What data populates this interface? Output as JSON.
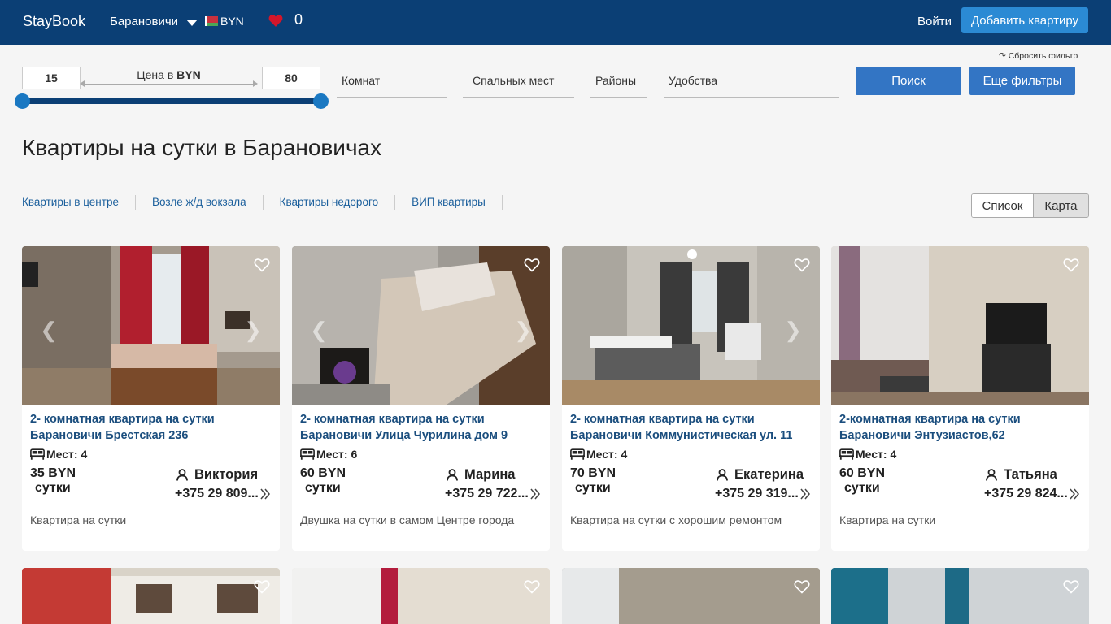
{
  "header": {
    "logo": "StayBook",
    "city": "Барановичи",
    "currency": "BYN",
    "favorites_count": "0",
    "login": "Войти",
    "add_apartment": "Добавить квартиру",
    "brand_color": "#0b3f75"
  },
  "filters": {
    "reset": "↷ Сбросить фильтр",
    "price_min": "15",
    "price_max": "80",
    "price_label_prefix": "Цена в ",
    "price_label_currency": "BYN",
    "rooms": "Комнат",
    "sleeping_places": "Спальных мест",
    "districts": "Районы",
    "amenities": "Удобства",
    "search": "Поиск",
    "more_filters": "Еще фильтры"
  },
  "page_title": "Квартиры на сутки в Барановичах",
  "quick_links": [
    "Квартиры в центре",
    "Возле ж/д вокзала",
    "Квартиры недорого",
    "ВИП квартиры"
  ],
  "view_toggle": {
    "list": "Список",
    "map": "Карта"
  },
  "listings": [
    {
      "title": "2- комнатная квартира на сутки Барановичи Брестская 236",
      "seats": "Мест: 4",
      "price": "35 BYN",
      "unit": "сутки",
      "owner": "Виктория",
      "phone": "+375 29 809...",
      "description": "Квартира на сутки"
    },
    {
      "title": "2- комнатная квартира на сутки Барановичи Улица Чурилина дом 9",
      "seats": "Мест: 6",
      "price": "60 BYN",
      "unit": "сутки",
      "owner": "Марина",
      "phone": "+375 29 722...",
      "description": "Двушка на сутки в самом Центре города"
    },
    {
      "title": "2- комнатная квартира на сутки Барановичи Коммунистическая ул. 11",
      "seats": "Мест: 4",
      "price": "70 BYN",
      "unit": "сутки",
      "owner": "Екатерина",
      "phone": "+375 29 319...",
      "description": "Квартира на сутки с хорошим ремонтом"
    },
    {
      "title": "2-комнатная квартира на сутки Барановичи Энтузиастов,62",
      "seats": "Мест: 4",
      "price": "60 BYN",
      "unit": "сутки",
      "owner": "Татьяна",
      "phone": "+375 29 824...",
      "description": "Квартира на сутки"
    }
  ]
}
